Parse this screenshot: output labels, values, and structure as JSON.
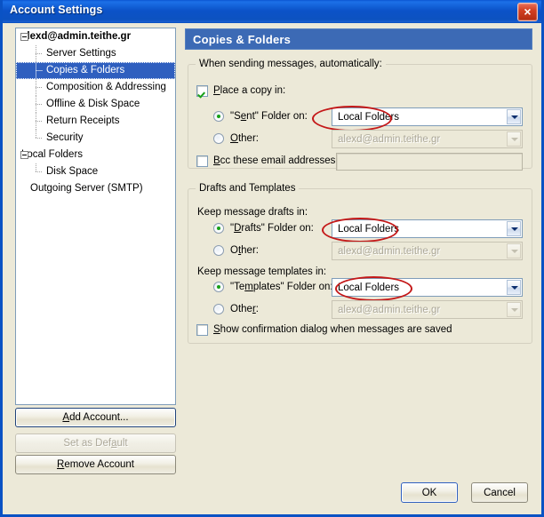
{
  "window": {
    "title": "Account Settings",
    "close_label": "×"
  },
  "sidebar": {
    "tree": [
      {
        "label": "alexd@admin.teithe.gr",
        "level": "root",
        "expander": true,
        "selected": false
      },
      {
        "label": "Server Settings",
        "level": "child",
        "expander": false,
        "selected": false
      },
      {
        "label": "Copies & Folders",
        "level": "child",
        "expander": false,
        "selected": true
      },
      {
        "label": "Composition & Addressing",
        "level": "child",
        "expander": false,
        "selected": false
      },
      {
        "label": "Offline & Disk Space",
        "level": "child",
        "expander": false,
        "selected": false
      },
      {
        "label": "Return Receipts",
        "level": "child",
        "expander": false,
        "selected": false
      },
      {
        "label": "Security",
        "level": "child",
        "expander": false,
        "selected": false
      },
      {
        "label": "Local Folders",
        "level": "root-plain",
        "expander": true,
        "selected": false
      },
      {
        "label": "Disk Space",
        "level": "child",
        "expander": false,
        "selected": false
      },
      {
        "label": "Outgoing Server (SMTP)",
        "level": "toplevel",
        "expander": false,
        "selected": false
      }
    ],
    "buttons": {
      "add_account": {
        "label": "Add Account...",
        "underline_index": 0,
        "enabled": true,
        "default": true
      },
      "set_as_default": {
        "label": "Set as Default",
        "underline_index": 8,
        "enabled": false,
        "default": false
      },
      "remove_account": {
        "label": "Remove Account",
        "underline_index": 0,
        "enabled": true,
        "default": false
      }
    }
  },
  "main": {
    "header_title": "Copies & Folders",
    "group_sending": {
      "title": "When sending messages, automatically:",
      "place_copy": {
        "label": "Place a copy in:",
        "checked": true
      },
      "sent_folder": {
        "label": "\"Sent\" Folder on:",
        "selected": true,
        "value": "Local Folders"
      },
      "other_sent": {
        "label": "Other:",
        "selected": false,
        "value": "alexd@admin.teithe.gr",
        "disabled": true
      },
      "bcc": {
        "label": "Bcc these email addresses:",
        "checked": false,
        "value": "",
        "disabled": true
      }
    },
    "group_drafts": {
      "title": "Drafts and Templates",
      "drafts_heading": "Keep message drafts in:",
      "drafts_folder": {
        "label": "\"Drafts\" Folder on:",
        "selected": true,
        "value": "Local Folders"
      },
      "drafts_other": {
        "label": "Other:",
        "selected": false,
        "value": "alexd@admin.teithe.gr",
        "disabled": true
      },
      "templates_heading": "Keep message templates in:",
      "templates_folder": {
        "label": "\"Templates\" Folder on:",
        "selected": true,
        "value": "Local Folders"
      },
      "templates_other": {
        "label": "Other:",
        "selected": false,
        "value": "alexd@admin.teithe.gr",
        "disabled": true
      },
      "show_confirmation": {
        "label": "Show confirmation dialog when messages are saved",
        "checked": false
      }
    }
  },
  "footer": {
    "ok_label": "OK",
    "cancel_label": "Cancel"
  },
  "annotations": {
    "color": "#c41818",
    "count": 3,
    "targets": [
      "Local Folders (Sent)",
      "Local Folders (Drafts)",
      "Local Folders (Templates)"
    ]
  }
}
